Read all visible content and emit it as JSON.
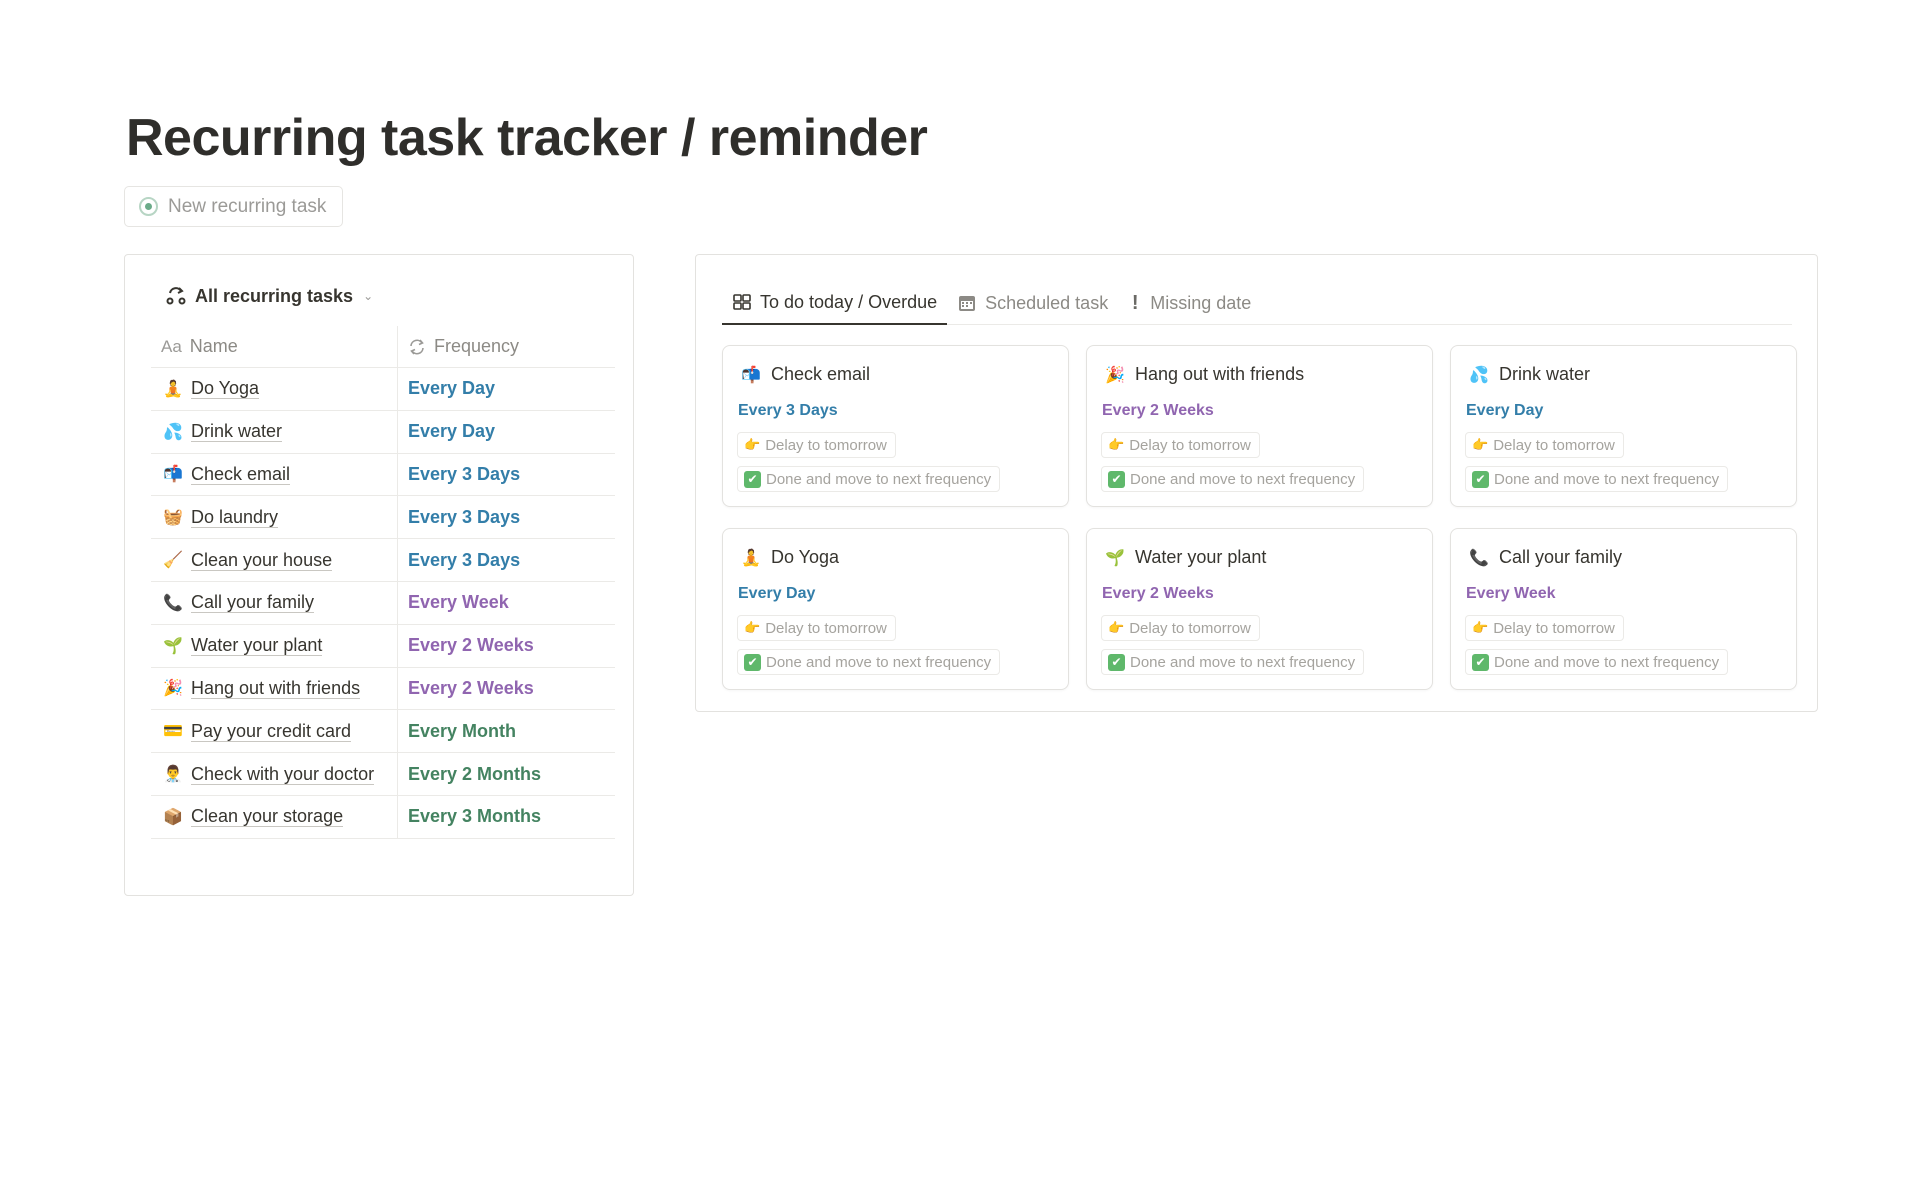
{
  "page": {
    "title": "Recurring task tracker / reminder",
    "new_button_label": "New recurring task"
  },
  "left_view": {
    "title": "All recurring tasks",
    "columns": {
      "name": "Name",
      "name_prefix": "Aa",
      "frequency": "Frequency"
    },
    "rows": [
      {
        "emoji": "🧘",
        "name": "Do Yoga",
        "frequency": "Every Day",
        "color": "#337ea9"
      },
      {
        "emoji": "💦",
        "name": "Drink water",
        "frequency": "Every Day",
        "color": "#337ea9"
      },
      {
        "emoji": "📬",
        "name": "Check email",
        "frequency": "Every 3 Days",
        "color": "#337ea9"
      },
      {
        "emoji": "🧺",
        "name": "Do laundry",
        "frequency": "Every 3 Days",
        "color": "#337ea9"
      },
      {
        "emoji": "🧹",
        "name": "Clean your house",
        "frequency": "Every 3 Days",
        "color": "#337ea9"
      },
      {
        "emoji": "📞",
        "name": "Call your family",
        "frequency": "Every Week",
        "color": "#9065b0"
      },
      {
        "emoji": "🌱",
        "name": "Water your plant",
        "frequency": "Every 2 Weeks",
        "color": "#9065b0"
      },
      {
        "emoji": "🎉",
        "name": "Hang out with friends",
        "frequency": "Every 2 Weeks",
        "color": "#9065b0"
      },
      {
        "emoji": "💳",
        "name": "Pay your credit card",
        "frequency": "Every Month",
        "color": "#448361"
      },
      {
        "emoji": "👨‍⚕️",
        "name": "Check with your doctor",
        "frequency": "Every 2 Months",
        "color": "#448361"
      },
      {
        "emoji": "📦",
        "name": "Clean your storage",
        "frequency": "Every 3 Months",
        "color": "#448361"
      }
    ]
  },
  "right_view": {
    "tabs": [
      {
        "label": "To do today / Overdue",
        "icon": "gallery-icon",
        "active": true
      },
      {
        "label": "Scheduled task",
        "icon": "calendar-icon",
        "active": false
      },
      {
        "label": "Missing date",
        "icon": "exclamation-icon",
        "active": false
      }
    ],
    "delay_label": "Delay to tomorrow",
    "done_label": "Done and move to next frequency",
    "delay_emoji": "👉",
    "done_emoji": "✔",
    "cards": [
      {
        "emoji": "📬",
        "title": "Check email",
        "frequency": "Every 3 Days",
        "color": "#337ea9"
      },
      {
        "emoji": "🎉",
        "title": "Hang out with friends",
        "frequency": "Every 2 Weeks",
        "color": "#9065b0"
      },
      {
        "emoji": "💦",
        "title": "Drink water",
        "frequency": "Every Day",
        "color": "#337ea9"
      },
      {
        "emoji": "🧘",
        "title": "Do Yoga",
        "frequency": "Every Day",
        "color": "#337ea9"
      },
      {
        "emoji": "🌱",
        "title": "Water your plant",
        "frequency": "Every 2 Weeks",
        "color": "#9065b0"
      },
      {
        "emoji": "📞",
        "title": "Call your family",
        "frequency": "Every Week",
        "color": "#9065b0"
      }
    ]
  }
}
